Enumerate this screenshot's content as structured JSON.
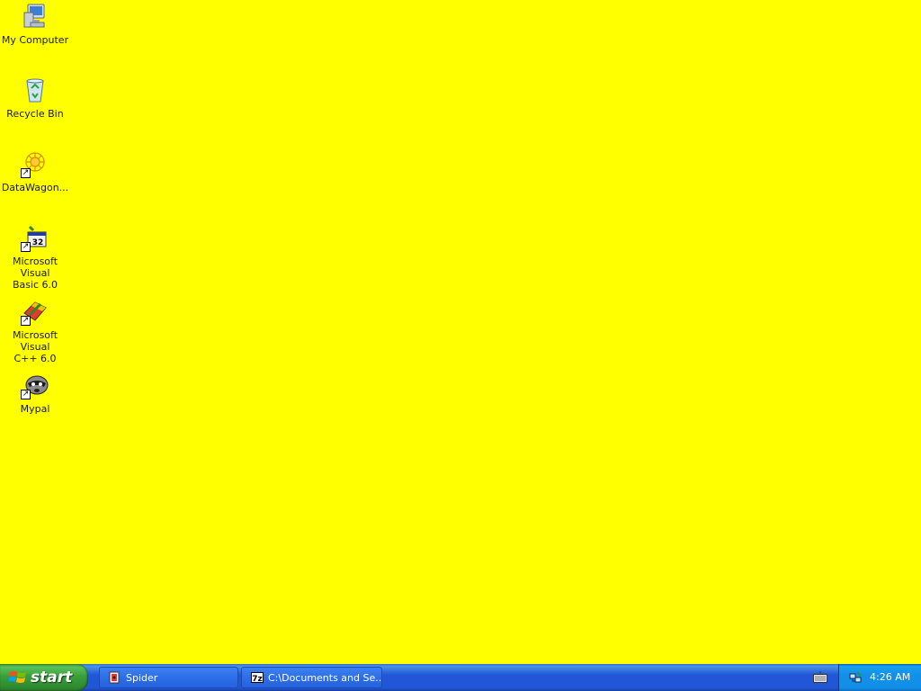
{
  "desktop": {
    "background_color": "#ffff00",
    "icons": [
      {
        "label": "My Computer",
        "icon": "my-computer-icon",
        "shortcut": false
      },
      {
        "label": "Recycle Bin",
        "icon": "recycle-bin-icon",
        "shortcut": false
      },
      {
        "label": "DataWagon...",
        "icon": "datawagon-icon",
        "shortcut": true
      },
      {
        "label": "Microsoft Visual\nBasic 6.0",
        "icon": "visual-basic-icon",
        "shortcut": true
      },
      {
        "label": "Microsoft Visual\nC++ 6.0",
        "icon": "visual-cpp-icon",
        "shortcut": true
      },
      {
        "label": "Mypal",
        "icon": "mypal-icon",
        "shortcut": true
      }
    ]
  },
  "taskbar": {
    "start_label": "start",
    "tasks": [
      {
        "label": "Spider",
        "icon": "spider-solitaire-icon"
      },
      {
        "label": "C:\\Documents and Se...",
        "icon": "7zip-icon"
      }
    ],
    "tray": {
      "clock": "4:26 AM",
      "icons": [
        "keyboard-icon",
        "network-icon"
      ]
    }
  }
}
